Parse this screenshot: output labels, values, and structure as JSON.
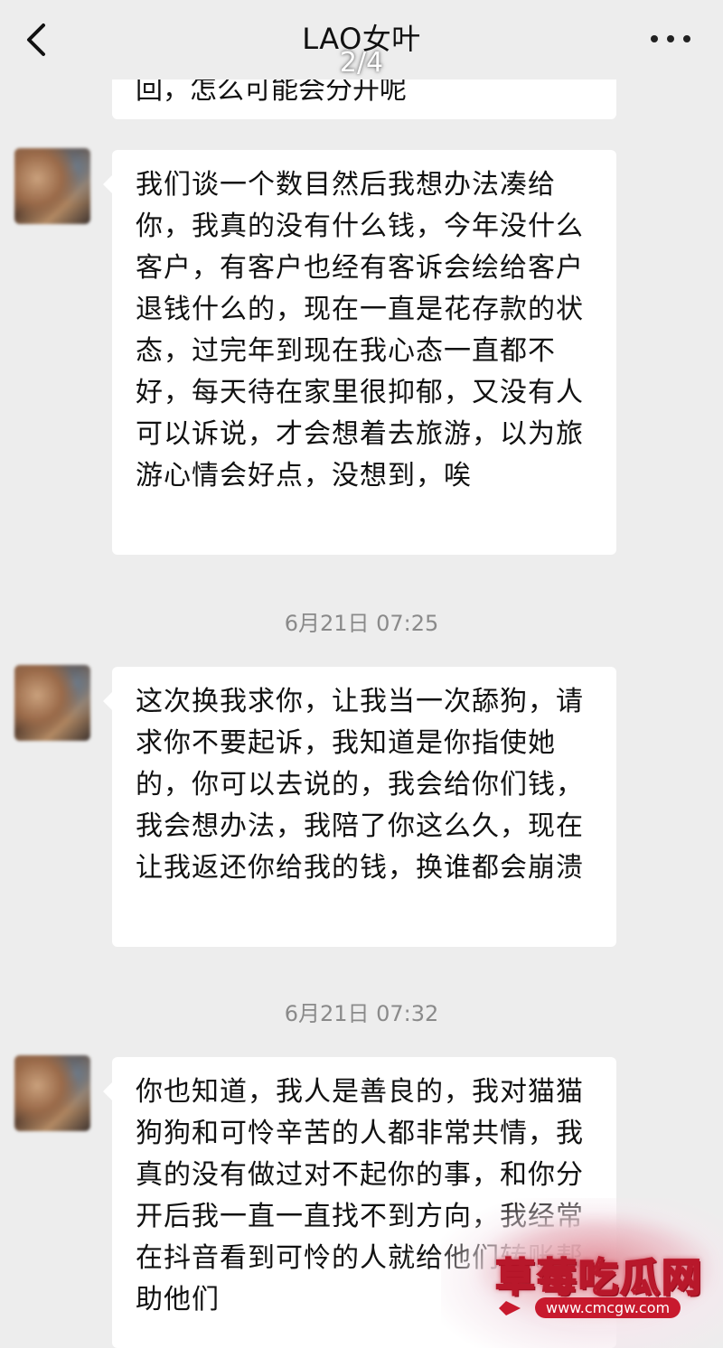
{
  "header": {
    "title": "LAO女叶",
    "page_indicator": "2/4",
    "back_icon": "chevron-left-icon",
    "more_icon": "more-dots-icon"
  },
  "messages": [
    {
      "id": "partial",
      "text": "回，怎么可能会分开呢"
    },
    {
      "id": "m1",
      "text": "我们谈一个数目然后我想办法凑给你，我真的没有什么钱，今年没什么客户，有客户也经有客诉会绘给客户退钱什么的，现在一直是花存款的状态，过完年到现在我心态一直都不好，每天待在家里很抑郁，又没有人可以诉说，才会想着去旅游，以为旅游心情会好点，没想到，唉"
    },
    {
      "id": "m2",
      "timestamp": "6月21日 07:25",
      "text": "这次换我求你，让我当一次舔狗，请求你不要起诉，我知道是你指使她的，你可以去说的，我会给你们钱，我会想办法，我陪了你这么久，现在让我返还你给我的钱，换谁都会崩溃"
    },
    {
      "id": "m3",
      "timestamp": "6月21日 07:32",
      "text": "你也知道，我人是善良的，我对猫猫狗狗和可怜辛苦的人都非常共情，我真的没有做过对不起你的事，和你分开后我一直一直找不到方向，我经常在抖音看到可怜的人就给他们转账帮助他们"
    }
  ],
  "watermark": {
    "text": "草莓吃瓜网",
    "url": "www.cmcgw.com"
  },
  "colors": {
    "background": "#ededed",
    "bubble": "#ffffff",
    "timestamp": "#8a8a8a",
    "watermark_red": "#c81a2e"
  }
}
